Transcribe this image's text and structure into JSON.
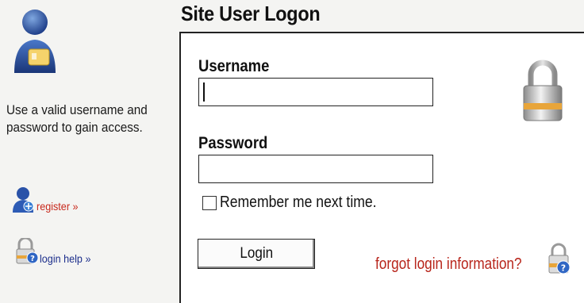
{
  "page": {
    "title": "Site User Logon"
  },
  "sidebar": {
    "help_text": "Use a valid username and password to gain access.",
    "links": [
      {
        "label": "register »",
        "icon": "user-add-icon",
        "color": "#c8281c"
      },
      {
        "label": "login help »",
        "icon": "lock-help-icon",
        "color": "#1d2f8c"
      }
    ]
  },
  "form": {
    "username_label": "Username",
    "username_value": "",
    "password_label": "Password",
    "password_value": "",
    "remember_label": "Remember me next time.",
    "remember_checked": false,
    "login_button": "Login",
    "forgot_label": "forgot login information?"
  },
  "colors": {
    "accent_red": "#c8281c",
    "link_blue": "#1d2f8c",
    "lock_orange": "#e8a53a"
  }
}
